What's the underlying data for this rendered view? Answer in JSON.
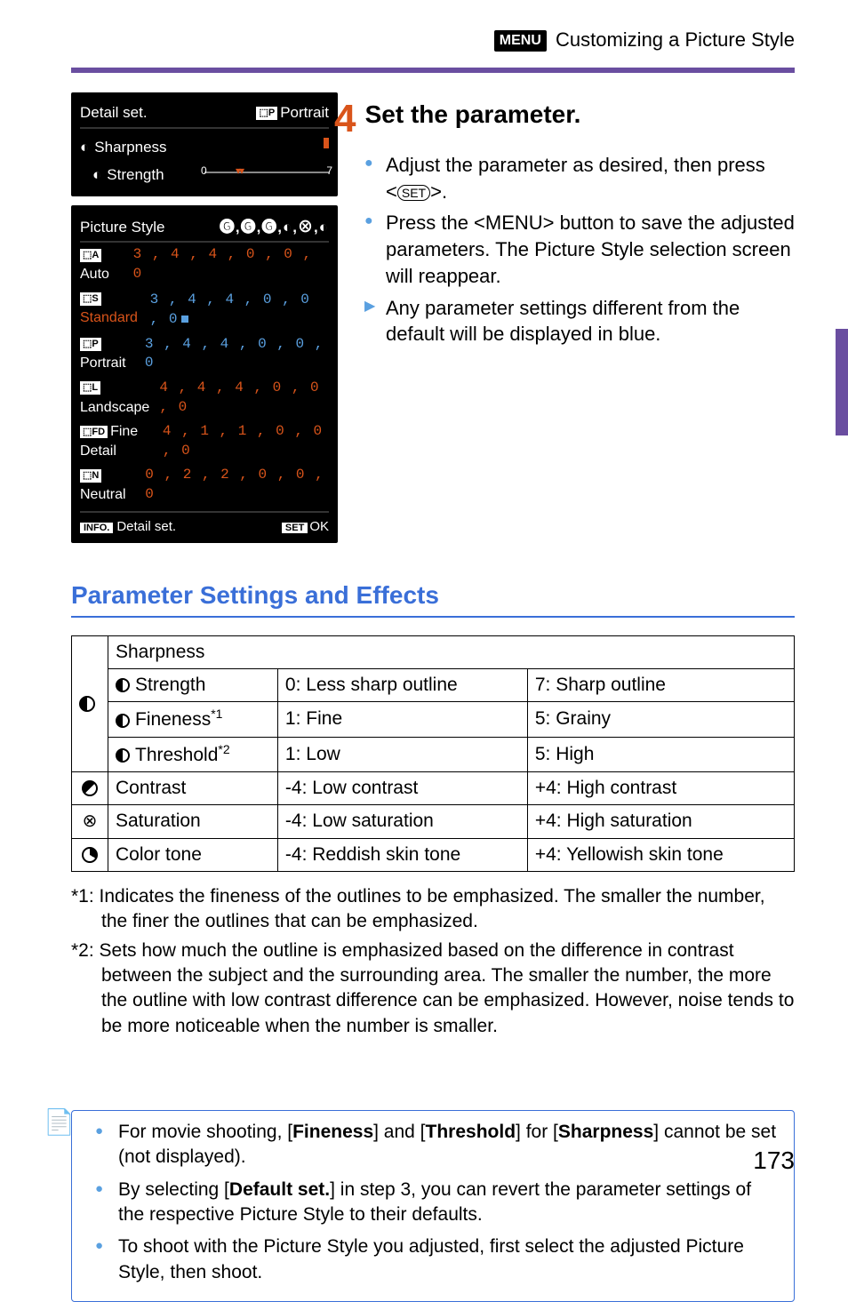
{
  "header": {
    "menu_label": "MENU",
    "title": "Customizing a Picture Style"
  },
  "camera": {
    "detail_title": "Detail set.",
    "detail_style": "Portrait",
    "sharpness_label": "Sharpness",
    "strength_label": "Strength",
    "slider_start": "0",
    "slider_end": "7",
    "picture_style_label": "Picture Style",
    "header_icons": "🅖,🅖,🅖,◐,⊗,◐",
    "rows": [
      {
        "name": "Auto",
        "vals": "3 , 4 , 4 , 0 , 0 , 0",
        "color": "orange"
      },
      {
        "name": "Standard",
        "vals": "3 , 4 , 4 , 0 , 0 , 0",
        "color": "blue",
        "marked": true
      },
      {
        "name": "Portrait",
        "vals": "3 , 4 , 4 , 0 , 0 , 0",
        "color": "blue"
      },
      {
        "name": "Landscape",
        "vals": "4 , 4 , 4 , 0 , 0 , 0",
        "color": "orange"
      },
      {
        "name": "Fine Detail",
        "vals": "4 , 1 , 1 , 0 , 0 , 0",
        "color": "orange"
      },
      {
        "name": "Neutral",
        "vals": "0 , 2 , 2 , 0 , 0 , 0",
        "color": "orange"
      }
    ],
    "footer_info": "INFO.",
    "footer_detail": "Detail set.",
    "footer_set": "SET",
    "footer_ok": "OK"
  },
  "step": {
    "number": "4",
    "title": "Set the parameter.",
    "bullets": [
      {
        "type": "dot",
        "text_pre": "Adjust the parameter as desired, then press <",
        "oval": "SET",
        "text_post": ">."
      },
      {
        "type": "dot",
        "text_pre": "Press the <",
        "menu": "MENU",
        "text_post": "> button to save the adjusted parameters. The Picture Style selection screen will reappear."
      },
      {
        "type": "arrow",
        "text_pre": "Any parameter settings different from the default will be displayed in blue."
      }
    ]
  },
  "section_title": "Parameter Settings and Effects",
  "table": {
    "sharpness_header": "Sharpness",
    "rows": [
      {
        "sub": "Strength",
        "low": "0: Less sharp outline",
        "high": "7: Sharp outline"
      },
      {
        "sub": "Fineness",
        "sup": "*1",
        "low": "1: Fine",
        "high": "5: Grainy"
      },
      {
        "sub": "Threshold",
        "sup": "*2",
        "low": "1: Low",
        "high": "5: High"
      }
    ],
    "contrast": {
      "label": "Contrast",
      "low": "-4: Low contrast",
      "high": "+4: High contrast"
    },
    "saturation": {
      "label": "Saturation",
      "low": "-4: Low saturation",
      "high": "+4: High saturation"
    },
    "colortone": {
      "label": "Color tone",
      "low": "-4: Reddish skin tone",
      "high": "+4: Yellowish skin tone"
    }
  },
  "footnotes": {
    "f1": "*1: Indicates the fineness of the outlines to be emphasized. The smaller the number, the finer the outlines that can be emphasized.",
    "f2": "*2: Sets how much the outline is emphasized based on the difference in contrast between the subject and the surrounding area. The smaller the number, the more the outline with low contrast difference can be emphasized. However, noise tends to be more noticeable when the number is smaller."
  },
  "notes": {
    "n1_pre": "For movie shooting, [",
    "n1_b1": "Fineness",
    "n1_mid1": "] and [",
    "n1_b2": "Threshold",
    "n1_mid2": "] for [",
    "n1_b3": "Sharpness",
    "n1_post": "] cannot be set (not displayed).",
    "n2_pre": "By selecting [",
    "n2_b": "Default set.",
    "n2_post": "] in step 3, you can revert the parameter settings of the respective Picture Style to their defaults.",
    "n3": "To shoot with the Picture Style you adjusted, first select the adjusted Picture Style, then shoot."
  },
  "page_number": "173"
}
